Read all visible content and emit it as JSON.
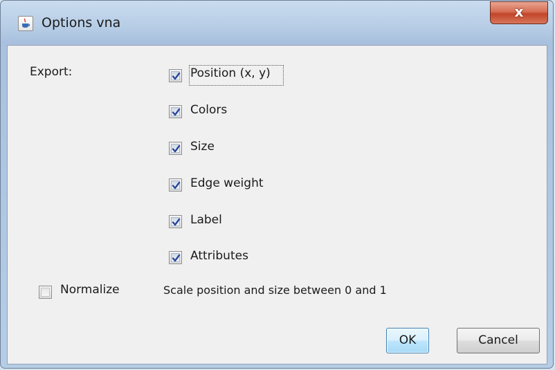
{
  "window": {
    "title": "Options vna",
    "close_symbol": "x"
  },
  "export_label": "Export:",
  "export_options": [
    {
      "label": "Position (x, y)",
      "checked": true
    },
    {
      "label": "Colors",
      "checked": true
    },
    {
      "label": "Size",
      "checked": true
    },
    {
      "label": "Edge weight",
      "checked": true
    },
    {
      "label": "Label",
      "checked": true
    },
    {
      "label": "Attributes",
      "checked": true
    }
  ],
  "normalize": {
    "label": "Normalize",
    "checked": false,
    "description": "Scale position and size between 0 and 1"
  },
  "buttons": {
    "ok": "OK",
    "cancel": "Cancel"
  },
  "colors": {
    "check": "#27459a",
    "default_button_border": "#3c7fb1",
    "close_button": "#c2452a"
  },
  "icons": {
    "app": "java-cup-icon",
    "check": "checkmark-icon",
    "close": "close-icon"
  }
}
